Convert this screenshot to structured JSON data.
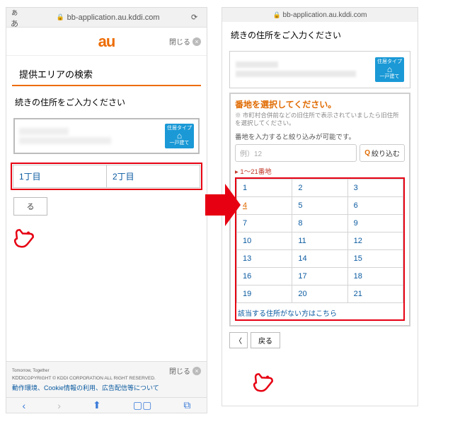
{
  "url": "bb-application.au.kddi.com",
  "aa_label": "ぁあ",
  "brand": "au",
  "close_label": "閉じる",
  "left": {
    "section_title": "提供エリアの検索",
    "instruction": "続きの住所をご入力ください",
    "badge_top": "住居タイプ",
    "badge_bottom": "一戸建て",
    "chome": [
      "1丁目",
      "2丁目"
    ],
    "back": "る",
    "copyright_prefix": "Tomorrow, Together",
    "kddi": "KDDI",
    "copyright": "COPYRIGHT © KDDI CORPORATION ALL RIGHT RESERVED.",
    "footer_link": "動作環境、Cookie情報の利用、広告配信等について"
  },
  "right": {
    "title": "続きの住所をご入力ください",
    "badge_top": "住居タイプ",
    "badge_bottom": "一戸建て",
    "select_title": "番地を選択してください。",
    "select_note": "※ 市町村合併前などの旧住所で表示されていましたら旧住所を選択してください。",
    "filter_label": "番地を入力すると絞り込みが可能です。",
    "filter_placeholder": "例）12",
    "filter_button": "絞り込む",
    "range_label": "▸ 1〜21番地",
    "numbers": [
      [
        "1",
        "2",
        "3"
      ],
      [
        "4",
        "5",
        "6"
      ],
      [
        "7",
        "8",
        "9"
      ],
      [
        "10",
        "11",
        "12"
      ],
      [
        "13",
        "14",
        "15"
      ],
      [
        "16",
        "17",
        "18"
      ],
      [
        "19",
        "20",
        "21"
      ]
    ],
    "highlighted": "4",
    "no_address": "該当する住所がない方はこちら",
    "back": "戻る"
  }
}
